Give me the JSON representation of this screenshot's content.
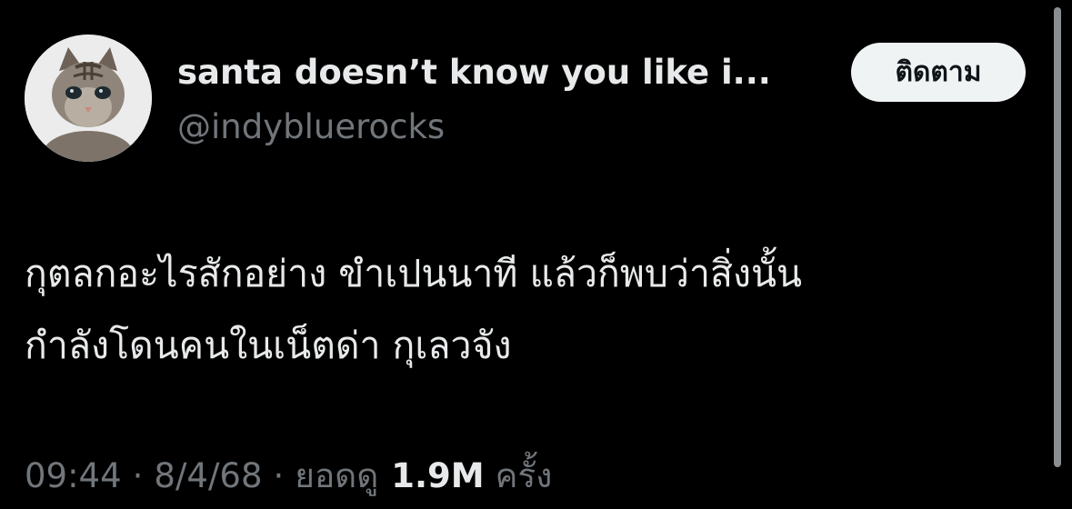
{
  "author": {
    "display_name": "santa doesn’t know you like i...",
    "handle": "@indybluerocks",
    "avatar": "kitten-photo"
  },
  "follow_button": {
    "label": "ติดตาม"
  },
  "tweet": {
    "lines": [
      "กุตลกอะไรสักอย่าง ขำเปนนาที แล้วก็พบว่าสิ่งนั้น",
      "กำลังโดนคนในเน็ตด่า กุเลวจัง"
    ]
  },
  "meta": {
    "time": "09:44",
    "separator": "·",
    "date": "8/4/68",
    "views_prefix": "ยอดดู",
    "views_count": "1.9M",
    "views_suffix": "ครั้ง"
  },
  "colors": {
    "background": "#000000",
    "primary_text": "#e7e9ea",
    "secondary_text": "#71767b",
    "button_bg": "#eff3f4"
  }
}
